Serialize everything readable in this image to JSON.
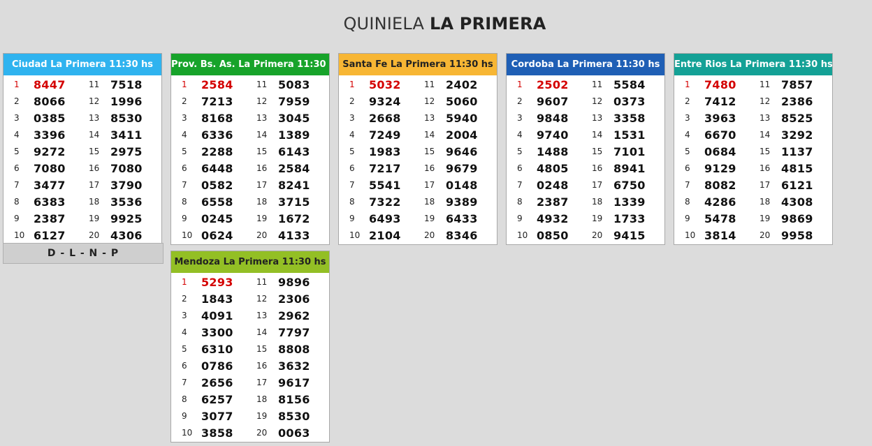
{
  "title": {
    "light": "QUINIELA ",
    "bold": "LA PRIMERA"
  },
  "footer_label": "D - L - N - P",
  "cards": [
    {
      "title": "Ciudad La Primera 11:30 hs",
      "color": "#2fb3ef",
      "left_numbers": [
        "8447",
        "8066",
        "0385",
        "3396",
        "9272",
        "7080",
        "3477",
        "6383",
        "2387",
        "6127"
      ],
      "right_numbers": [
        "7518",
        "1996",
        "8530",
        "3411",
        "2975",
        "7080",
        "3790",
        "3536",
        "9925",
        "4306"
      ]
    },
    {
      "title": "Prov. Bs. As. La Primera 11:30 hs",
      "color": "#17a32a",
      "left_numbers": [
        "2584",
        "7213",
        "8168",
        "6336",
        "2288",
        "6448",
        "0582",
        "6558",
        "0245",
        "0624"
      ],
      "right_numbers": [
        "5083",
        "7959",
        "3045",
        "1389",
        "6143",
        "2584",
        "8241",
        "3715",
        "1672",
        "4133"
      ]
    },
    {
      "title": "Santa Fe La Primera 11:30 hs",
      "color": "#f7b634",
      "left_numbers": [
        "5032",
        "9324",
        "2668",
        "7249",
        "1983",
        "7217",
        "5541",
        "7322",
        "6493",
        "2104"
      ],
      "right_numbers": [
        "2402",
        "5060",
        "5940",
        "2004",
        "9646",
        "9679",
        "0148",
        "9389",
        "6433",
        "8346"
      ]
    },
    {
      "title": "Cordoba La Primera 11:30 hs",
      "color": "#1f5fb5",
      "left_numbers": [
        "2502",
        "9607",
        "9848",
        "9740",
        "1488",
        "4805",
        "0248",
        "2387",
        "4932",
        "0850"
      ],
      "right_numbers": [
        "5584",
        "0373",
        "3358",
        "1531",
        "7101",
        "8941",
        "6750",
        "1339",
        "1733",
        "9415"
      ]
    },
    {
      "title": "Entre Rios La Primera 11:30 hs",
      "color": "#14a196",
      "left_numbers": [
        "7480",
        "7412",
        "3963",
        "6670",
        "0684",
        "9129",
        "8082",
        "4286",
        "5478",
        "3814"
      ],
      "right_numbers": [
        "7857",
        "2386",
        "8525",
        "3292",
        "1137",
        "4815",
        "6121",
        "4308",
        "9869",
        "9958"
      ]
    },
    {
      "title": "Mendoza La Primera 11:30 hs",
      "color": "#93bf25",
      "left_numbers": [
        "5293",
        "1843",
        "4091",
        "3300",
        "6310",
        "0786",
        "2656",
        "6257",
        "3077",
        "3858"
      ],
      "right_numbers": [
        "9896",
        "2306",
        "2962",
        "7797",
        "8808",
        "3632",
        "9617",
        "8156",
        "8530",
        "0063"
      ]
    }
  ]
}
